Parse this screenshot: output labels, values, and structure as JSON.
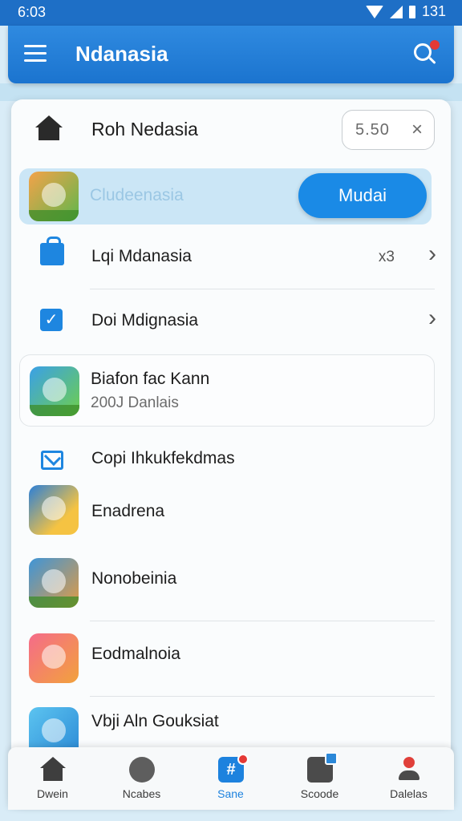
{
  "status_bar": {
    "time": "6:03",
    "right_text": "131"
  },
  "app_bar": {
    "title": "Ndanasia"
  },
  "card": {
    "header": {
      "title": "Roh Nedasia",
      "pill_value": "5.50",
      "close_glyph": "×"
    },
    "highlight_row": {
      "placeholder": "Cludeenasia",
      "button_label": "Mudai"
    },
    "rows": [
      {
        "label": "Lqi Mdanasia",
        "meta": "x3",
        "chevron": "›"
      },
      {
        "label": "Doi Mdignasia",
        "chevron": "›"
      }
    ],
    "sub_card": {
      "title": "Biafon fac Kann",
      "subtitle": "200J Danlais"
    },
    "section_label": "Copi Ihkukfekdmas",
    "apps": [
      {
        "label": "Enadrena"
      },
      {
        "label": "Nonobeinia"
      },
      {
        "label": "Eodmalnoia"
      },
      {
        "label": "Vbji Aln Gouksiat"
      }
    ]
  },
  "bottom_nav": [
    {
      "label": "Dwein",
      "icon": "home-icon"
    },
    {
      "label": "Ncabes",
      "icon": "circle-icon"
    },
    {
      "label": "Sane",
      "icon": "hash-icon",
      "glyph": "#",
      "active": true
    },
    {
      "label": "Scoode",
      "icon": "box-icon"
    },
    {
      "label": "Dalelas",
      "icon": "person-icon"
    }
  ],
  "colors": {
    "primary": "#1e6fc6",
    "accent": "#1a8ae6",
    "badge": "#e53935"
  }
}
